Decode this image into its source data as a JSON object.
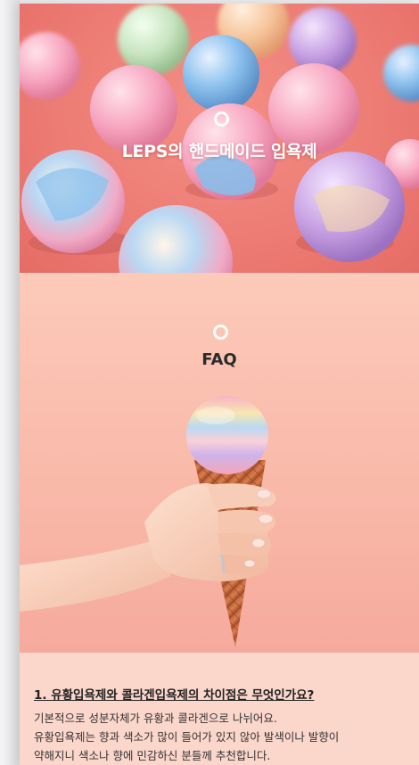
{
  "hero": {
    "title": "LEPS의 핸드메이드 입욕제"
  },
  "faq": {
    "title": "FAQ",
    "items": [
      {
        "question": "1. 유황입욕제와 콜라겐입욕제의 차이점은 무엇인가요?",
        "answer_lines": [
          "기본적으로 성분자체가 유황과 콜라겐으로 나뉘어요.",
          "유황입욕제는 향과 색소가 많이 들어가 있지 않아 발색이나 발향이",
          "약해지니 색소나 향에 민감하신 분들께 추천합니다."
        ]
      }
    ]
  },
  "colors": {
    "hero_background": "#ec7b73",
    "faq_background": "#fccab9",
    "qa_background": "#fbd6cb"
  }
}
